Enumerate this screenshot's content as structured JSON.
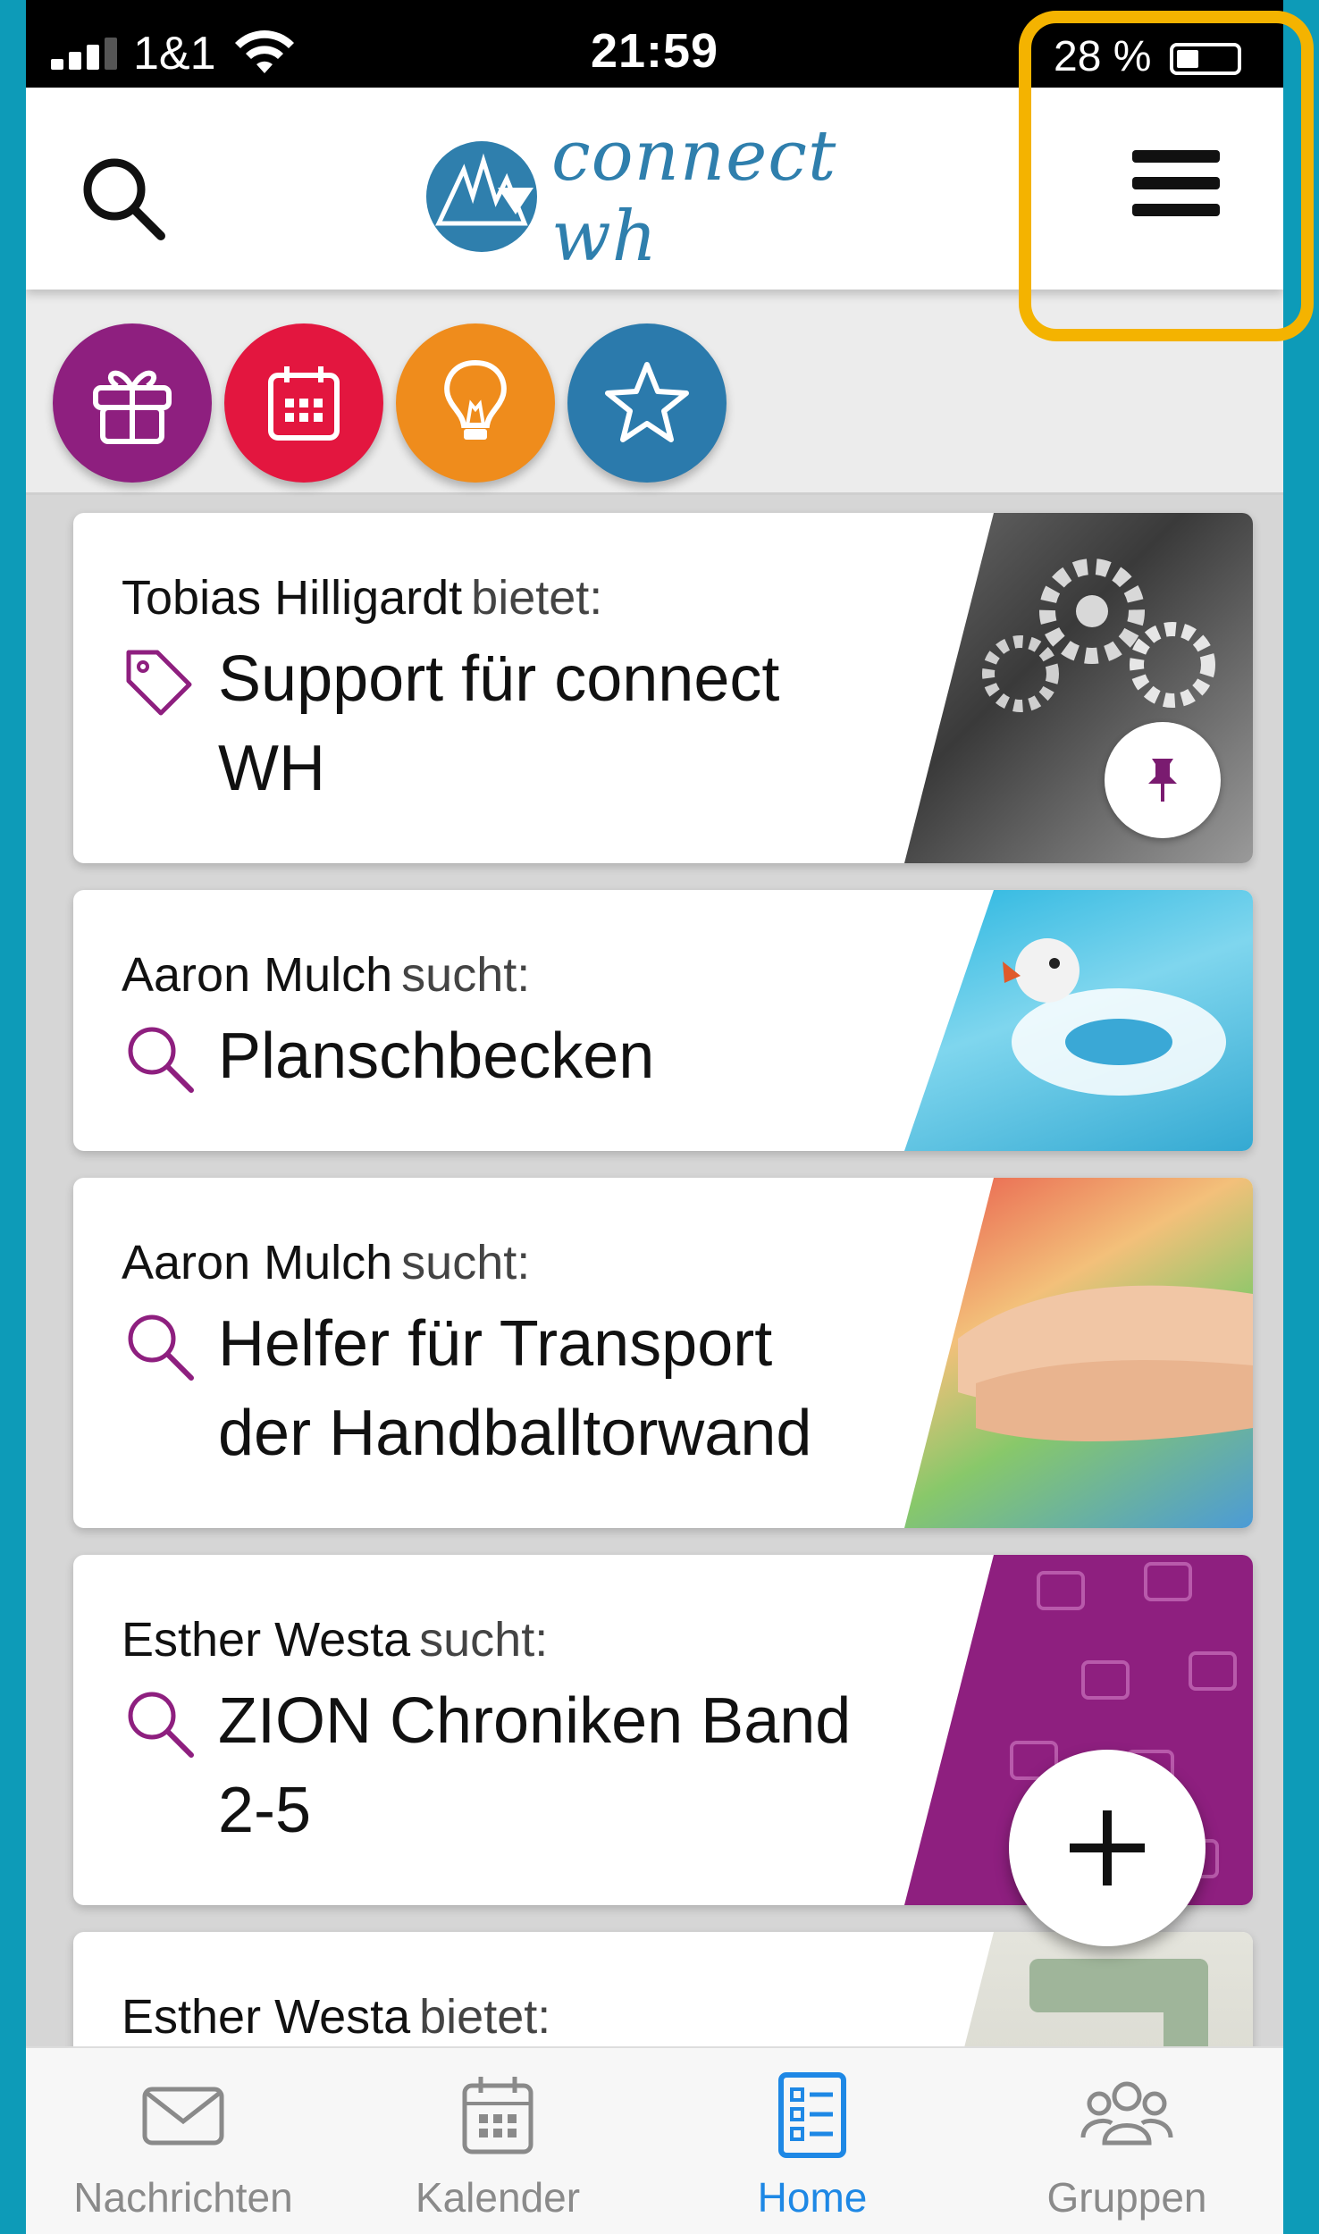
{
  "status_bar": {
    "carrier": "1&1",
    "time": "21:59",
    "battery_text": "28 %"
  },
  "header": {
    "logo_text": "connect wh",
    "search_icon": "search-icon",
    "menu_icon": "hamburger-menu-icon"
  },
  "categories": [
    {
      "name": "gift-icon",
      "color": "#8e1f7f"
    },
    {
      "name": "calendar-icon",
      "color": "#e3163f"
    },
    {
      "name": "lightbulb-icon",
      "color": "#ef8c1c"
    },
    {
      "name": "star-icon",
      "color": "#2b7aac"
    }
  ],
  "feed": [
    {
      "author": "Tobias Hilligardt",
      "verb": "bietet:",
      "icon": "tag-icon",
      "title_lines": [
        "Support für connect",
        "WH"
      ],
      "pinned": true
    },
    {
      "author": "Aaron Mulch",
      "verb": "sucht:",
      "icon": "search-icon",
      "title_lines": [
        "Planschbecken"
      ],
      "pinned": false
    },
    {
      "author": "Aaron Mulch",
      "verb": "sucht:",
      "icon": "search-icon",
      "title_lines": [
        "Helfer für Transport",
        "der Handballtorwand"
      ],
      "pinned": false
    },
    {
      "author": "Esther Westa",
      "verb": "sucht:",
      "icon": "search-icon",
      "title_lines": [
        "ZION Chroniken Band",
        "2-5"
      ],
      "pinned": false
    },
    {
      "author": "Esther Westa",
      "verb": "bietet:",
      "icon": "tag-icon",
      "title_lines": [],
      "pinned": false
    }
  ],
  "bottom_nav": [
    {
      "label": "Nachrichten",
      "icon": "mail-icon",
      "active": false
    },
    {
      "label": "Kalender",
      "icon": "calendar-icon",
      "active": false
    },
    {
      "label": "Home",
      "icon": "list-icon",
      "active": true
    },
    {
      "label": "Gruppen",
      "icon": "group-icon",
      "active": false
    }
  ],
  "colors": {
    "accent_purple": "#8e1f7f",
    "active_blue": "#1e88e5",
    "brand_blue": "#2f7fad",
    "highlight_yellow": "#f4b300"
  }
}
